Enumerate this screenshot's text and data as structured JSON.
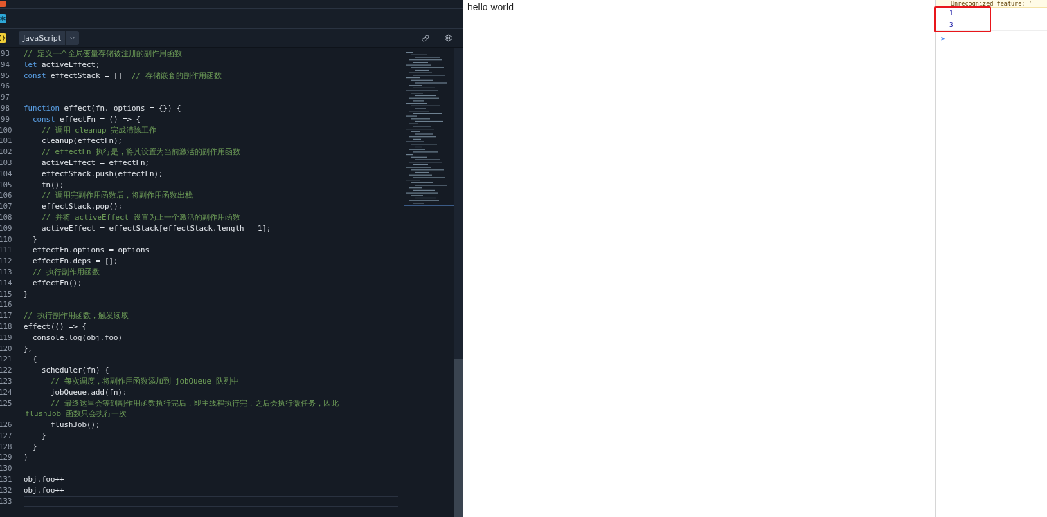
{
  "editor": {
    "language": "JavaScript",
    "lines": [
      {
        "number": "93",
        "tokens": [
          {
            "kind": "comment",
            "text": "// 定义一个全局变量存储被注册的副作用函数"
          }
        ]
      },
      {
        "number": "94",
        "tokens": [
          {
            "kind": "keyword",
            "text": "let"
          },
          {
            "kind": "plain",
            "text": " activeEffect;"
          }
        ]
      },
      {
        "number": "95",
        "tokens": [
          {
            "kind": "keyword",
            "text": "const"
          },
          {
            "kind": "plain",
            "text": " effectStack = []  "
          },
          {
            "kind": "comment",
            "text": "// 存储嵌套的副作用函数"
          }
        ]
      },
      {
        "number": "96"
      },
      {
        "number": "97"
      },
      {
        "number": "98",
        "tokens": [
          {
            "kind": "keyword",
            "text": "function"
          },
          {
            "kind": "plain",
            "text": " effect(fn, options = {}) {"
          }
        ]
      },
      {
        "number": "99",
        "tokens": [
          {
            "kind": "keyword",
            "text": "  const"
          },
          {
            "kind": "plain",
            "text": " effectFn = () => {"
          }
        ]
      },
      {
        "number": "100",
        "tokens": [
          {
            "kind": "comment",
            "text": "    // 调用 cleanup 完成清除工作"
          }
        ]
      },
      {
        "number": "101",
        "tokens": [
          {
            "kind": "plain",
            "text": "    cleanup(effectFn);"
          }
        ]
      },
      {
        "number": "102",
        "tokens": [
          {
            "kind": "comment",
            "text": "    // effectFn 执行是，将其设置为当前激活的副作用函数"
          }
        ]
      },
      {
        "number": "103",
        "tokens": [
          {
            "kind": "plain",
            "text": "    activeEffect = effectFn;"
          }
        ]
      },
      {
        "number": "104",
        "tokens": [
          {
            "kind": "plain",
            "text": "    effectStack.push(effectFn);"
          }
        ]
      },
      {
        "number": "105",
        "tokens": [
          {
            "kind": "plain",
            "text": "    fn();"
          }
        ]
      },
      {
        "number": "106",
        "tokens": [
          {
            "kind": "comment",
            "text": "    // 调用完副作用函数后，将副作用函数出栈"
          }
        ]
      },
      {
        "number": "107",
        "tokens": [
          {
            "kind": "plain",
            "text": "    effectStack.pop();"
          }
        ]
      },
      {
        "number": "108",
        "tokens": [
          {
            "kind": "comment",
            "text": "    // 并将 activeEffect 设置为上一个激活的副作用函数"
          }
        ]
      },
      {
        "number": "109",
        "tokens": [
          {
            "kind": "plain",
            "text": "    activeEffect = effectStack[effectStack.length - 1];"
          }
        ]
      },
      {
        "number": "110",
        "tokens": [
          {
            "kind": "plain",
            "text": "  }"
          }
        ]
      },
      {
        "number": "111",
        "tokens": [
          {
            "kind": "plain",
            "text": "  effectFn.options = options"
          }
        ]
      },
      {
        "number": "112",
        "tokens": [
          {
            "kind": "plain",
            "text": "  effectFn.deps = [];"
          }
        ]
      },
      {
        "number": "113",
        "tokens": [
          {
            "kind": "comment",
            "text": "  // 执行副作用函数"
          }
        ]
      },
      {
        "number": "114",
        "tokens": [
          {
            "kind": "plain",
            "text": "  effectFn();"
          }
        ]
      },
      {
        "number": "115",
        "tokens": [
          {
            "kind": "plain",
            "text": "}"
          }
        ]
      },
      {
        "number": "116"
      },
      {
        "number": "117",
        "tokens": [
          {
            "kind": "comment",
            "text": "// 执行副作用函数，触发读取"
          }
        ]
      },
      {
        "number": "118",
        "tokens": [
          {
            "kind": "plain",
            "text": "effect(() => {"
          }
        ]
      },
      {
        "number": "119",
        "tokens": [
          {
            "kind": "plain",
            "text": "  console.log(obj.foo)"
          }
        ]
      },
      {
        "number": "120",
        "tokens": [
          {
            "kind": "plain",
            "text": "},"
          }
        ]
      },
      {
        "number": "121",
        "tokens": [
          {
            "kind": "plain",
            "text": "  {"
          }
        ]
      },
      {
        "number": "122",
        "tokens": [
          {
            "kind": "plain",
            "text": "    scheduler(fn) {"
          }
        ]
      },
      {
        "number": "123",
        "tokens": [
          {
            "kind": "comment",
            "text": "      // 每次调度，将副作用函数添加到 jobQueue 队列中"
          }
        ]
      },
      {
        "number": "124",
        "tokens": [
          {
            "kind": "plain",
            "text": "      jobQueue.add(fn);"
          }
        ]
      },
      {
        "number": "125",
        "tokens": [
          {
            "kind": "comment",
            "text": "      // 最终这里会等到副作用函数执行完后，即主线程执行完，之后会执行微任务，因此"
          }
        ],
        "wrapped": "flushJob 函数只会执行一次"
      },
      {
        "number": "126",
        "tokens": [
          {
            "kind": "plain",
            "text": "      flushJob();"
          }
        ]
      },
      {
        "number": "127",
        "tokens": [
          {
            "kind": "plain",
            "text": "    }"
          }
        ]
      },
      {
        "number": "128",
        "tokens": [
          {
            "kind": "plain",
            "text": "  }"
          }
        ]
      },
      {
        "number": "129",
        "tokens": [
          {
            "kind": "plain",
            "text": ")"
          }
        ]
      },
      {
        "number": "130"
      },
      {
        "number": "131",
        "tokens": [
          {
            "kind": "plain",
            "text": "obj.foo++"
          }
        ]
      },
      {
        "number": "132",
        "tokens": [
          {
            "kind": "plain",
            "text": "obj.foo++"
          }
        ]
      },
      {
        "number": "133",
        "current": true
      }
    ]
  },
  "preview": {
    "text": "hello world"
  },
  "console": {
    "warning": "Unrecognized feature: '",
    "logs": [
      "1",
      "3"
    ],
    "prompt": ">"
  }
}
